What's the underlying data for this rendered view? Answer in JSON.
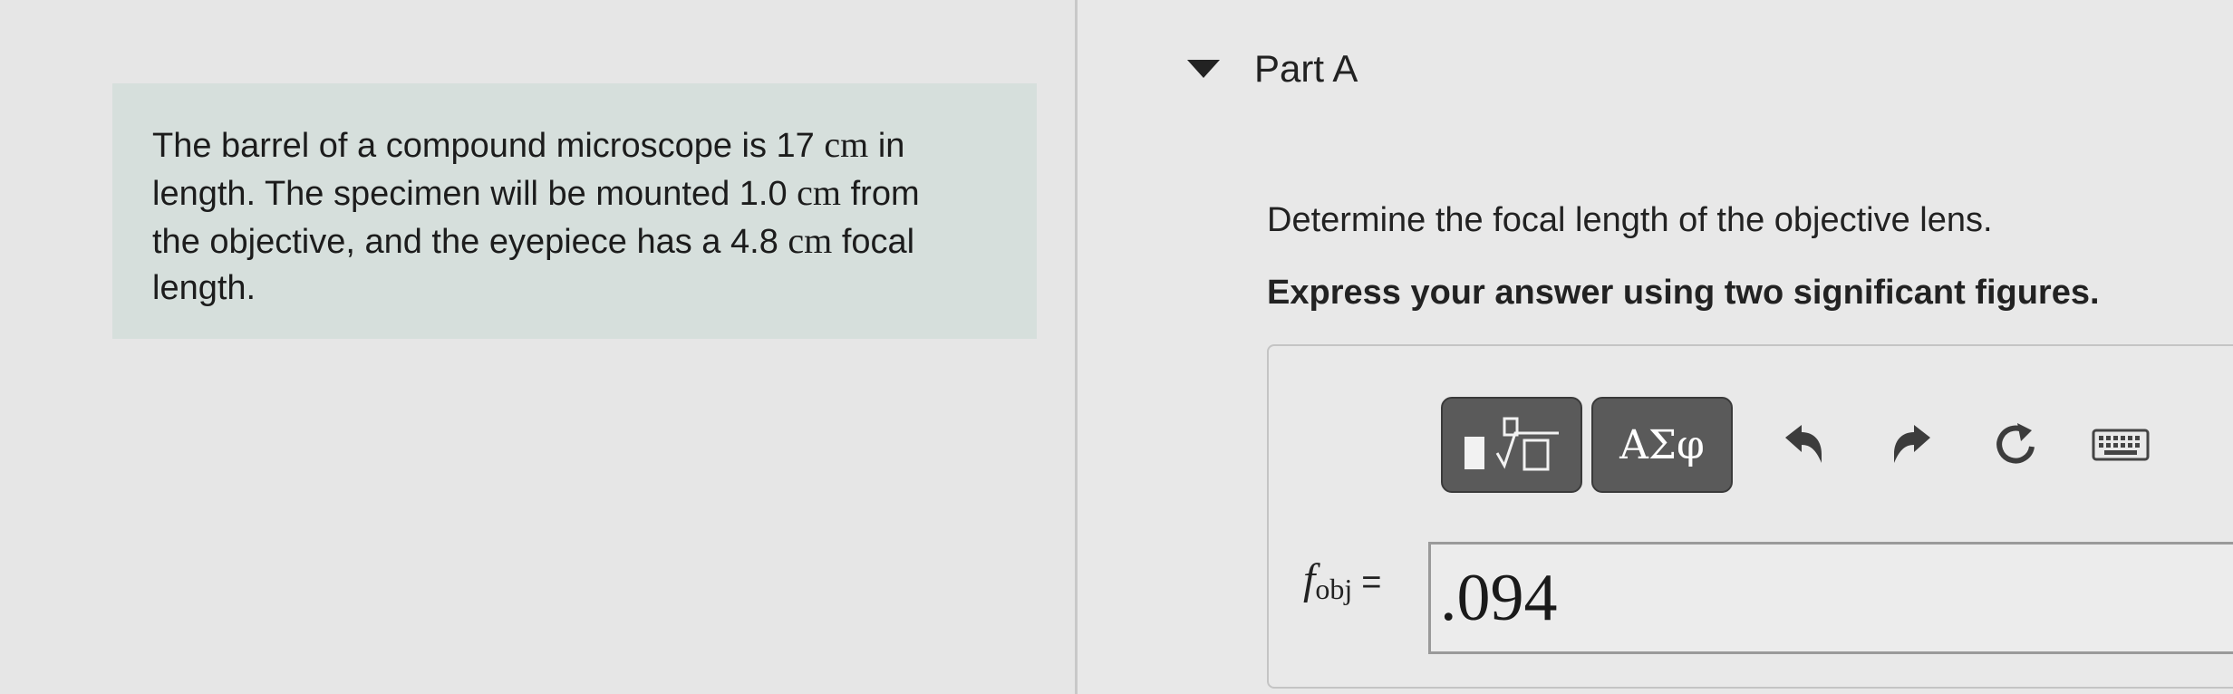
{
  "problem": {
    "line1_pre": "The barrel of a compound microscope is 17",
    "line1_unit": "cm",
    "line1_post": "in",
    "line2_pre": "length. The specimen will be mounted 1.0",
    "line2_unit": "cm",
    "line2_post": "from",
    "line3_pre": "the objective, and the eyepiece has a 4.8",
    "line3_unit": "cm",
    "line3_post": "focal",
    "line4": "length."
  },
  "part": {
    "title": "Part A",
    "question": "Determine the focal length of the objective lens.",
    "instruction": "Express your answer using two significant figures."
  },
  "toolbar": {
    "greek_label": "ΑΣφ",
    "icons": [
      "templates-icon",
      "undo-icon",
      "redo-icon",
      "reset-icon",
      "keyboard-icon"
    ]
  },
  "answer": {
    "var": "f",
    "sub": "obj",
    "equals": "=",
    "value": ".094"
  },
  "colors": {
    "problem_bg": "#d6dfdc",
    "toolbar_btn": "#5a5a5a"
  }
}
